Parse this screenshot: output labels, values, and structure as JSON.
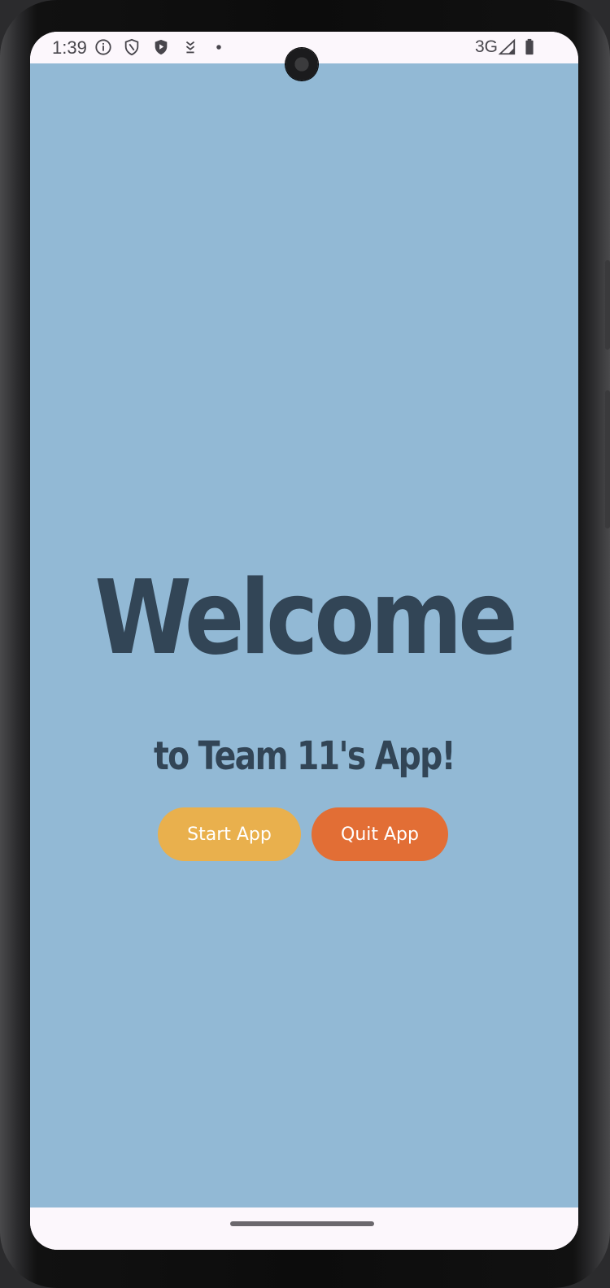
{
  "status_bar": {
    "time": "1:39",
    "network": "3G",
    "icons": [
      "info-icon",
      "shield-icon",
      "play-protect-icon",
      "download-icon",
      "dot-icon",
      "signal-icon",
      "battery-icon"
    ]
  },
  "main": {
    "title": "Welcome",
    "subtitle": "to Team 11's App!",
    "start_label": "Start App",
    "quit_label": "Quit App"
  },
  "colors": {
    "background": "#92b9d5",
    "text": "#324556",
    "start_button": "#e9b04d",
    "quit_button": "#e26e35"
  }
}
